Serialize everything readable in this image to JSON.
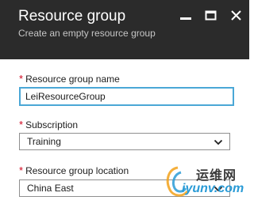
{
  "header": {
    "title": "Resource group",
    "subtitle": "Create an empty resource group"
  },
  "window_controls": {
    "minimize_icon": "minimize-icon",
    "maximize_icon": "maximize-icon",
    "close_icon": "close-icon"
  },
  "form": {
    "required_marker": "*",
    "name": {
      "label": "Resource group name",
      "value": "LeiResourceGroup"
    },
    "subscription": {
      "label": "Subscription",
      "selected": "Training"
    },
    "location": {
      "label": "Resource group location",
      "selected": "China East"
    }
  },
  "watermark": {
    "text_cn": "运维网",
    "text_en": "iyunv.com"
  },
  "colors": {
    "header_bg": "#2b2b2b",
    "required": "#d0021b",
    "focus_border": "#4aa7d6"
  }
}
